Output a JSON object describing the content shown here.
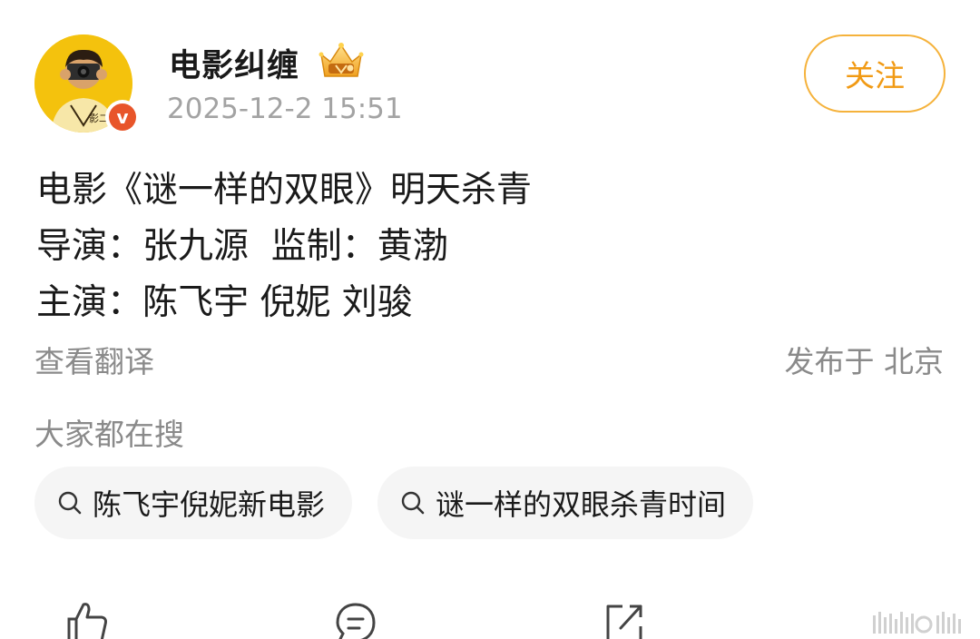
{
  "post": {
    "username": "电影纠缠",
    "timestamp": "2025-12-2 15:51",
    "follow_label": "关注",
    "verified_badge": "v",
    "content_lines": [
      "电影《谜一样的双眼》明天杀青",
      "导演：张九源  监制：黄渤",
      "主演：陈飞宇 倪妮 刘骏"
    ],
    "translate_label": "查看翻译",
    "location_text": "发布于 北京"
  },
  "hot_search": {
    "title": "大家都在搜",
    "items": [
      {
        "label": "陈飞宇倪妮新电影",
        "icon": "search-icon"
      },
      {
        "label": "谜一样的双眼杀青时间",
        "icon": "search-icon"
      }
    ]
  },
  "actions": [
    {
      "icon": "like-icon"
    },
    {
      "icon": "comment-icon"
    },
    {
      "icon": "share-icon"
    }
  ],
  "colors": {
    "accent": "#f19a14",
    "follow_border": "#f5b23b",
    "muted_text": "#8a8a8a",
    "chip_bg": "#f5f5f5",
    "verified": "#e8552a"
  }
}
